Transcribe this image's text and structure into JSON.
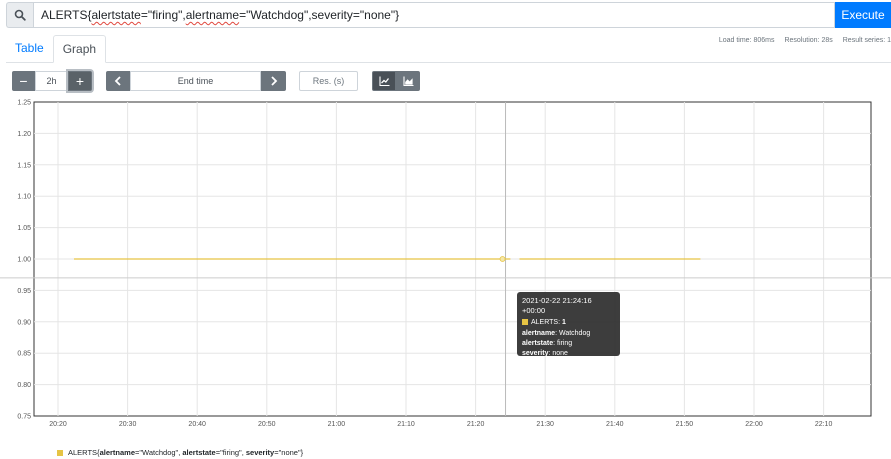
{
  "query": {
    "metric": "ALERTS{",
    "k1": "alertstate",
    "v1": "=\"firing\",",
    "k2": "alertname",
    "v2": "=\"Watchdog\",severity=\"none\"}",
    "execute_label": "Execute"
  },
  "tabs": [
    {
      "label": "Table",
      "active": false
    },
    {
      "label": "Graph",
      "active": true
    }
  ],
  "stats": {
    "load_time": "Load time: 806ms",
    "resolution": "Resolution: 28s",
    "result_series": "Result series: 1"
  },
  "controls": {
    "minus": "−",
    "range": "2h",
    "plus": "+",
    "prev": "‹",
    "end_time": "End time",
    "next": "›",
    "resolution_placeholder": "Res. (s)",
    "line_icon": "line-chart-icon",
    "stacked_icon": "area-chart-icon"
  },
  "chart_data": {
    "type": "line",
    "y_ticks": [
      "1.25",
      "1.20",
      "1.15",
      "1.10",
      "1.05",
      "1.00",
      "0.95",
      "0.90",
      "0.85",
      "0.80",
      "0.75"
    ],
    "ylim": [
      0.75,
      1.25
    ],
    "x_ticks": [
      "20:20",
      "20:30",
      "20:40",
      "20:50",
      "21:00",
      "21:10",
      "21:20",
      "21:30",
      "21:40",
      "21:50",
      "22:00",
      "22:10"
    ],
    "x_start_min": 1220,
    "x_step_min": 10,
    "series": [
      {
        "name": "ALERTS",
        "color": "#e6c444",
        "segments": [
          {
            "x_from": 1222.3,
            "x_to": 1285.0,
            "y": 1
          },
          {
            "x_from": 1286.3,
            "x_to": 1312.3,
            "y": 1
          }
        ]
      }
    ],
    "hover": {
      "x": 1284.3,
      "y": 1,
      "y_cross": 0.97
    }
  },
  "tooltip": {
    "timestamp": "2021-02-22 21:24:16 +00:00",
    "series_name": "ALERTS:",
    "value": "1",
    "labels": [
      {
        "key": "alertname",
        "value": "Watchdog"
      },
      {
        "key": "alertstate",
        "value": "firing"
      },
      {
        "key": "severity",
        "value": "none"
      }
    ]
  },
  "legend": {
    "metric": "ALERTS",
    "open": "{",
    "k1": "alertname",
    "v1": "=\"Watchdog\",",
    "k2": "alertstate",
    "v2": "=\"firing\",",
    "k3": "severity",
    "v3": "=\"none\"}"
  },
  "colors": {
    "accent": "#007bff",
    "series": "#e6c444"
  }
}
